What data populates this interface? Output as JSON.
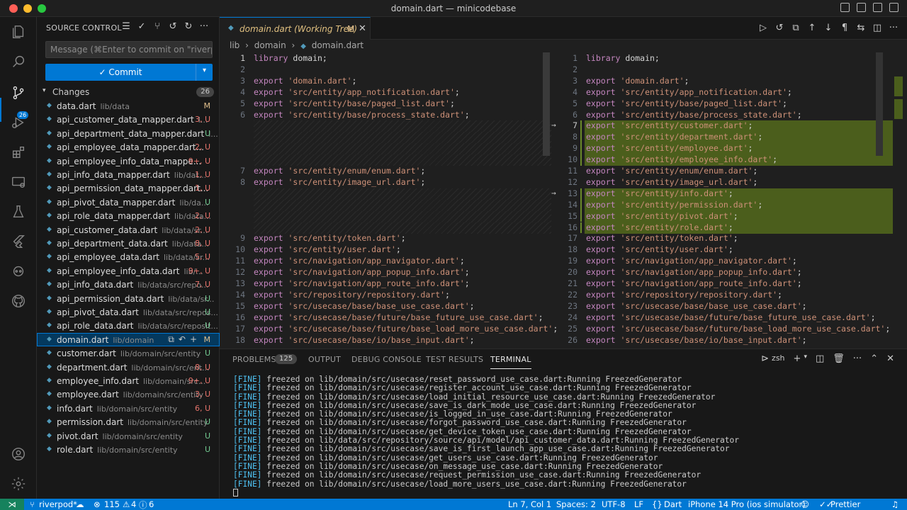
{
  "window": {
    "title": "domain.dart — minicodebase"
  },
  "colors": {
    "accent": "#0078d4",
    "added": "#4b5e1c",
    "modified": "#e2c08d",
    "untracked": "#73c991",
    "conflict": "#e5736b",
    "remote": "#16825d"
  },
  "activity": {
    "scm_badge": "26"
  },
  "sidebar": {
    "title": "SOURCE CONTROL",
    "message_placeholder": "Message (⌘Enter to commit on \"riverpo...",
    "commit_label": "✓ Commit",
    "changes_label": "Changes",
    "changes_count": "26",
    "files": [
      {
        "name": "data.dart",
        "path": "lib/data",
        "status": "M"
      },
      {
        "name": "api_customer_data_mapper.dart",
        "path": "l...",
        "status": "3, U"
      },
      {
        "name": "api_department_data_mapper.dart",
        "path": "l...",
        "status": "U"
      },
      {
        "name": "api_employee_data_mapper.dart...",
        "path": "",
        "status": "2, U"
      },
      {
        "name": "api_employee_info_data_mappe...",
        "path": "",
        "status": "9+, U"
      },
      {
        "name": "api_info_data_mapper.dart",
        "path": "lib/dat...",
        "status": "1, U"
      },
      {
        "name": "api_permission_data_mapper.dart...",
        "path": "",
        "status": "1, U"
      },
      {
        "name": "api_pivot_data_mapper.dart",
        "path": "lib/da...",
        "status": "U"
      },
      {
        "name": "api_role_data_mapper.dart",
        "path": "lib/data...",
        "status": "2, U"
      },
      {
        "name": "api_customer_data.dart",
        "path": "lib/data/sr...",
        "status": "2, U"
      },
      {
        "name": "api_department_data.dart",
        "path": "lib/data...",
        "status": "8, U"
      },
      {
        "name": "api_employee_data.dart",
        "path": "lib/data/sr...",
        "status": "5, U"
      },
      {
        "name": "api_employee_info_data.dart",
        "path": "lib/...",
        "status": "9+, U"
      },
      {
        "name": "api_info_data.dart",
        "path": "lib/data/src/repo...",
        "status": "7, U"
      },
      {
        "name": "api_permission_data.dart",
        "path": "lib/data/sr...",
        "status": "U"
      },
      {
        "name": "api_pivot_data.dart",
        "path": "lib/data/src/repos...",
        "status": "U"
      },
      {
        "name": "api_role_data.dart",
        "path": "lib/data/src/reposit...",
        "status": "U"
      },
      {
        "name": "domain.dart",
        "path": "lib/domain",
        "status": "M"
      },
      {
        "name": "customer.dart",
        "path": "lib/domain/src/entity",
        "status": "U"
      },
      {
        "name": "department.dart",
        "path": "lib/domain/src/ent...",
        "status": "8, U"
      },
      {
        "name": "employee_info.dart",
        "path": "lib/domain/src...",
        "status": "9+, U"
      },
      {
        "name": "employee.dart",
        "path": "lib/domain/src/entity",
        "status": "3, U"
      },
      {
        "name": "info.dart",
        "path": "lib/domain/src/entity",
        "status": "6, U"
      },
      {
        "name": "permission.dart",
        "path": "lib/domain/src/entity",
        "status": "U"
      },
      {
        "name": "pivot.dart",
        "path": "lib/domain/src/entity",
        "status": "U"
      },
      {
        "name": "role.dart",
        "path": "lib/domain/src/entity",
        "status": "U"
      }
    ]
  },
  "editor": {
    "tab": {
      "name": "domain.dart (Working Tree)",
      "badge": "M"
    },
    "breadcrumb": [
      "lib",
      "›",
      "domain",
      "›",
      "domain.dart"
    ],
    "left": [
      {
        "n": "1",
        "kw": "library",
        "rest": " domain;"
      },
      {
        "n": "2",
        "kw": "",
        "rest": ""
      },
      {
        "n": "3",
        "kw": "export",
        "str": "'domain.dart'"
      },
      {
        "n": "4",
        "kw": "export",
        "str": "'src/entity/app_notification.dart'"
      },
      {
        "n": "5",
        "kw": "export",
        "str": "'src/entity/base/paged_list.dart'"
      },
      {
        "n": "6",
        "kw": "export",
        "str": "'src/entity/base/process_state.dart'"
      },
      {
        "gap": true
      },
      {
        "gap": true
      },
      {
        "gap": true
      },
      {
        "gap": true
      },
      {
        "n": "7",
        "kw": "export",
        "str": "'src/entity/enum/enum.dart'"
      },
      {
        "n": "8",
        "kw": "export",
        "str": "'src/entity/image_url.dart'"
      },
      {
        "gap": true
      },
      {
        "gap": true
      },
      {
        "gap": true
      },
      {
        "gap": true
      },
      {
        "n": "9",
        "kw": "export",
        "str": "'src/entity/token.dart'"
      },
      {
        "n": "10",
        "kw": "export",
        "str": "'src/entity/user.dart'"
      },
      {
        "n": "11",
        "kw": "export",
        "str": "'src/navigation/app_navigator.dart'"
      },
      {
        "n": "12",
        "kw": "export",
        "str": "'src/navigation/app_popup_info.dart'"
      },
      {
        "n": "13",
        "kw": "export",
        "str": "'src/navigation/app_route_info.dart'"
      },
      {
        "n": "14",
        "kw": "export",
        "str": "'src/repository/repository.dart'"
      },
      {
        "n": "15",
        "kw": "export",
        "str": "'src/usecase/base/base_use_case.dart'"
      },
      {
        "n": "16",
        "kw": "export",
        "str": "'src/usecase/base/future/base_future_use_case.dart'"
      },
      {
        "n": "17",
        "kw": "export",
        "str": "'src/usecase/base/future/base_load_more_use_case.dart'"
      },
      {
        "n": "18",
        "kw": "export",
        "str": "'src/usecase/base/io/base_input.dart'"
      }
    ],
    "right": [
      {
        "n": "1",
        "kw": "library",
        "rest": " domain;"
      },
      {
        "n": "2",
        "kw": "",
        "rest": ""
      },
      {
        "n": "3",
        "kw": "export",
        "str": "'domain.dart'"
      },
      {
        "n": "4",
        "kw": "export",
        "str": "'src/entity/app_notification.dart'"
      },
      {
        "n": "5",
        "kw": "export",
        "str": "'src/entity/base/paged_list.dart'"
      },
      {
        "n": "6",
        "kw": "export",
        "str": "'src/entity/base/process_state.dart'"
      },
      {
        "n": "7",
        "kw": "export",
        "str": "'src/entity/customer.dart'",
        "add": true
      },
      {
        "n": "8",
        "kw": "export",
        "str": "'src/entity/department.dart'",
        "add": true
      },
      {
        "n": "9",
        "kw": "export",
        "str": "'src/entity/employee.dart'",
        "add": true
      },
      {
        "n": "10",
        "kw": "export",
        "str": "'src/entity/employee_info.dart'",
        "add": true
      },
      {
        "n": "11",
        "kw": "export",
        "str": "'src/entity/enum/enum.dart'"
      },
      {
        "n": "12",
        "kw": "export",
        "str": "'src/entity/image_url.dart'"
      },
      {
        "n": "13",
        "kw": "export",
        "str": "'src/entity/info.dart'",
        "add": true
      },
      {
        "n": "14",
        "kw": "export",
        "str": "'src/entity/permission.dart'",
        "add": true
      },
      {
        "n": "15",
        "kw": "export",
        "str": "'src/entity/pivot.dart'",
        "add": true
      },
      {
        "n": "16",
        "kw": "export",
        "str": "'src/entity/role.dart'",
        "add": true
      },
      {
        "n": "17",
        "kw": "export",
        "str": "'src/entity/token.dart'"
      },
      {
        "n": "18",
        "kw": "export",
        "str": "'src/entity/user.dart'"
      },
      {
        "n": "19",
        "kw": "export",
        "str": "'src/navigation/app_navigator.dart'"
      },
      {
        "n": "20",
        "kw": "export",
        "str": "'src/navigation/app_popup_info.dart'"
      },
      {
        "n": "21",
        "kw": "export",
        "str": "'src/navigation/app_route_info.dart'"
      },
      {
        "n": "22",
        "kw": "export",
        "str": "'src/repository/repository.dart'"
      },
      {
        "n": "23",
        "kw": "export",
        "str": "'src/usecase/base/base_use_case.dart'"
      },
      {
        "n": "24",
        "kw": "export",
        "str": "'src/usecase/base/future/base_future_use_case.dart'"
      },
      {
        "n": "25",
        "kw": "export",
        "str": "'src/usecase/base/future/base_load_more_use_case.dart'"
      },
      {
        "n": "26",
        "kw": "export",
        "str": "'src/usecase/base/io/base_input.dart'"
      }
    ]
  },
  "panel": {
    "tabs": [
      "PROBLEMS",
      "OUTPUT",
      "DEBUG CONSOLE",
      "TEST RESULTS",
      "TERMINAL"
    ],
    "problems_count": "125",
    "shell": "zsh",
    "lines": [
      "freezed on lib/domain/src/usecase/reset_password_use_case.dart:Running FreezedGenerator",
      "freezed on lib/domain/src/usecase/register_account_use_case.dart:Running FreezedGenerator",
      "freezed on lib/domain/src/usecase/load_initial_resource_use_case.dart:Running FreezedGenerator",
      "freezed on lib/domain/src/usecase/save_is_dark_mode_use_case.dart:Running FreezedGenerator",
      "freezed on lib/domain/src/usecase/is_logged_in_use_case.dart:Running FreezedGenerator",
      "freezed on lib/domain/src/usecase/forgot_password_use_case.dart:Running FreezedGenerator",
      "freezed on lib/domain/src/usecase/get_device_token_use_case.dart:Running FreezedGenerator",
      "freezed on lib/data/src/repository/source/api/model/api_customer_data.dart:Running FreezedGenerator",
      "freezed on lib/domain/src/usecase/save_is_first_launch_app_use_case.dart:Running FreezedGenerator",
      "freezed on lib/domain/src/usecase/get_users_use_case.dart:Running FreezedGenerator",
      "freezed on lib/domain/src/usecase/on_message_use_case.dart:Running FreezedGenerator",
      "freezed on lib/domain/src/usecase/request_permission_use_case.dart:Running FreezedGenerator",
      "freezed on lib/domain/src/usecase/load_more_users_use_case.dart:Running FreezedGenerator"
    ],
    "tag": "[FINE]"
  },
  "status": {
    "branch": "riverpod*",
    "errors": "115",
    "warnings": "4",
    "info": "6",
    "cursor": "Ln 7, Col 1",
    "spaces": "Spaces: 2",
    "encoding": "UTF-8",
    "eol": "LF",
    "lang": "Dart",
    "device": "iPhone 14 Pro (ios simulator)",
    "formatter": "Prettier"
  }
}
